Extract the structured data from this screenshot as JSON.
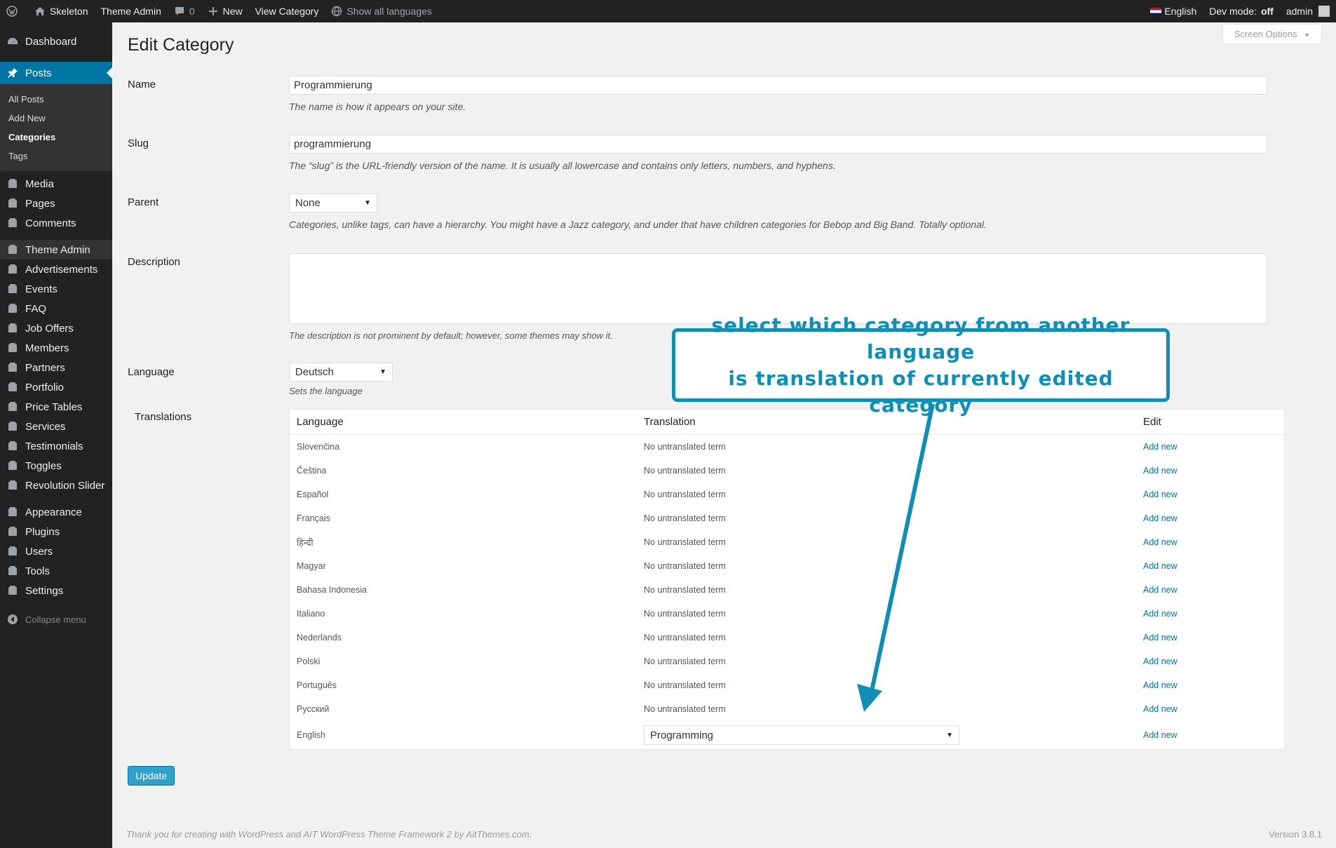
{
  "admin_bar": {
    "site_name": "Skeleton",
    "theme_admin": "Theme Admin",
    "comments_count": "0",
    "new_label": "New",
    "view_category": "View Category",
    "show_all_languages": "Show all languages",
    "language": "English",
    "dev_mode_label": "Dev mode:",
    "dev_mode_value": "off",
    "user": "admin"
  },
  "sidebar": {
    "dashboard": "Dashboard",
    "posts": "Posts",
    "posts_submenu": [
      "All Posts",
      "Add New",
      "Categories",
      "Tags"
    ],
    "items_group1": [
      "Media",
      "Pages",
      "Comments"
    ],
    "items_group2": [
      "Theme Admin",
      "Advertisements",
      "Events",
      "FAQ",
      "Job Offers",
      "Members",
      "Partners",
      "Portfolio",
      "Price Tables",
      "Services",
      "Testimonials",
      "Toggles",
      "Revolution Slider"
    ],
    "items_group3": [
      "Appearance",
      "Plugins",
      "Users",
      "Tools",
      "Settings"
    ],
    "collapse": "Collapse menu"
  },
  "screen_options": "Screen Options",
  "page_title": "Edit Category",
  "form": {
    "name_label": "Name",
    "name_value": "Programmierung",
    "name_desc": "The name is how it appears on your site.",
    "slug_label": "Slug",
    "slug_value": "programmierung",
    "slug_desc": "The “slug” is the URL-friendly version of the name. It is usually all lowercase and contains only letters, numbers, and hyphens.",
    "parent_label": "Parent",
    "parent_value": "None",
    "parent_desc": "Categories, unlike tags, can have a hierarchy. You might have a Jazz category, and under that have children categories for Bebop and Big Band. Totally optional.",
    "description_label": "Description",
    "description_desc": "The description is not prominent by default; however, some themes may show it.",
    "language_label": "Language",
    "language_value": "Deutsch",
    "language_desc": "Sets the language",
    "translations_label": "Translations"
  },
  "translations": {
    "headers": {
      "language": "Language",
      "translation": "Translation",
      "edit": "Edit"
    },
    "rows": [
      {
        "language": "Slovenčina",
        "translation": "No untranslated term",
        "edit": "Add new"
      },
      {
        "language": "Čeština",
        "translation": "No untranslated term",
        "edit": "Add new"
      },
      {
        "language": "Español",
        "translation": "No untranslated term",
        "edit": "Add new"
      },
      {
        "language": "Français",
        "translation": "No untranslated term",
        "edit": "Add new"
      },
      {
        "language": "हिन्दी",
        "translation": "No untranslated term",
        "edit": "Add new"
      },
      {
        "language": "Magyar",
        "translation": "No untranslated term",
        "edit": "Add new"
      },
      {
        "language": "Bahasa Indonesia",
        "translation": "No untranslated term",
        "edit": "Add new"
      },
      {
        "language": "Italiano",
        "translation": "No untranslated term",
        "edit": "Add new"
      },
      {
        "language": "Nederlands",
        "translation": "No untranslated term",
        "edit": "Add new"
      },
      {
        "language": "Polski",
        "translation": "No untranslated term",
        "edit": "Add new"
      },
      {
        "language": "Português",
        "translation": "No untranslated term",
        "edit": "Add new"
      },
      {
        "language": "Русский",
        "translation": "No untranslated term",
        "edit": "Add new"
      }
    ],
    "english": {
      "language": "English",
      "translation": "Programming",
      "edit": "Add new"
    }
  },
  "update_button": "Update",
  "footer": {
    "left": "Thank you for creating with WordPress and AIT WordPress Theme Framework 2 by AitThemes.com.",
    "version": "Version 3.8.1"
  },
  "callout": {
    "line1": "select which category from another language",
    "line2": "is translation of currently edited category"
  },
  "colors": {
    "accent": "#0074a2",
    "callout": "#0f8fb6",
    "button": "#2ea2cc"
  }
}
